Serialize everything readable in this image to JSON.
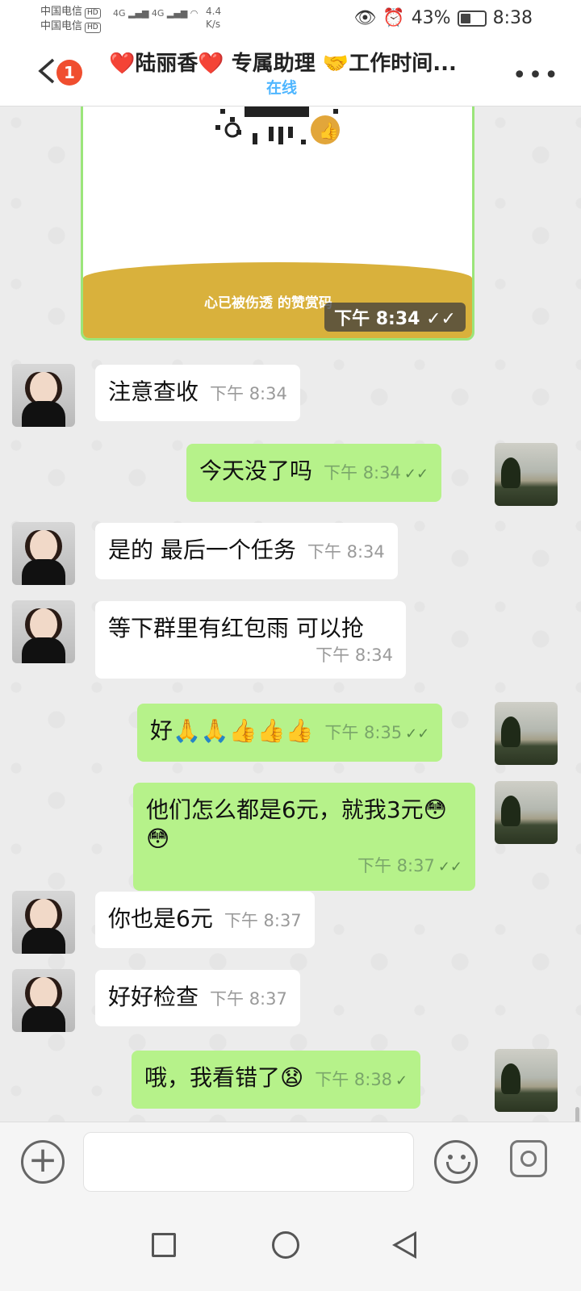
{
  "status_bar": {
    "carrier_1": "中国电信",
    "carrier_2": "中国电信",
    "hd": "HD",
    "network": "4G",
    "speed_value": "4.4",
    "speed_unit": "K/s",
    "battery": "43%",
    "battery_level": 0.43,
    "time": "8:38"
  },
  "header": {
    "unread_count": "1",
    "title": "❤️陆丽香❤️ 专属助理 🤝工作时间...",
    "subtitle": "在线"
  },
  "card": {
    "caption": "心已被伤透 的赞赏码",
    "time": "下午  8:34  ✓✓"
  },
  "messages": [
    {
      "text": "注意查收",
      "time": "下午  8:34",
      "ticks": ""
    },
    {
      "text": "今天没了吗",
      "time": "下午  8:34",
      "ticks": "✓✓"
    },
    {
      "text": "是的 最后一个任务",
      "time": "下午  8:34",
      "ticks": ""
    },
    {
      "text": "等下群里有红包雨 可以抢",
      "time": "下午  8:34",
      "ticks": ""
    },
    {
      "text": "好🙏🙏👍👍👍",
      "time": "下午  8:35",
      "ticks": "✓✓"
    },
    {
      "text": "他们怎么都是6元，就我3元😳😳",
      "time": "下午  8:37",
      "ticks": "✓✓"
    },
    {
      "text": "你也是6元",
      "time": "下午  8:37",
      "ticks": ""
    },
    {
      "text": "好好检查",
      "time": "下午  8:37",
      "ticks": ""
    },
    {
      "text": "哦，我看错了😧",
      "time": "下午  8:38",
      "ticks": "✓"
    }
  ]
}
